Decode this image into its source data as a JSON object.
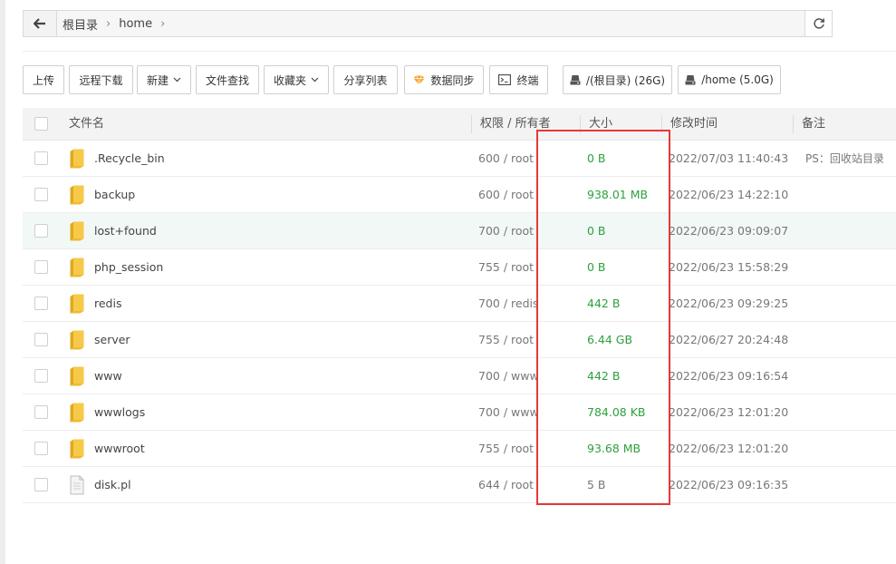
{
  "path": {
    "crumbs": [
      "根目录",
      "home"
    ],
    "back_icon": "arrow-left-icon",
    "refresh_icon": "refresh-icon"
  },
  "toolbar": {
    "upload": "上传",
    "remote_download": "远程下载",
    "new": "新建",
    "file_search": "文件查找",
    "favorites": "收藏夹",
    "share_list": "分享列表",
    "data_sync": "数据同步",
    "terminal": "终端",
    "disk_root": "/(根目录) (26G)",
    "disk_home": "/home (5.0G)"
  },
  "table": {
    "headers": {
      "name": "文件名",
      "perm": "权限 / 所有者",
      "size": "大小",
      "mtime": "修改时间",
      "note": "备注"
    },
    "rows": [
      {
        "name": ".Recycle_bin",
        "type": "folder",
        "perm": "600 / root",
        "size": "0 B",
        "mtime": "2022/07/03 11:40:43",
        "note": "PS：回收站目录"
      },
      {
        "name": "backup",
        "type": "folder",
        "perm": "600 / root",
        "size": "938.01 MB",
        "mtime": "2022/06/23 14:22:10",
        "note": ""
      },
      {
        "name": "lost+found",
        "type": "folder",
        "perm": "700 / root",
        "size": "0 B",
        "mtime": "2022/06/23 09:09:07",
        "note": ""
      },
      {
        "name": "php_session",
        "type": "folder",
        "perm": "755 / root",
        "size": "0 B",
        "mtime": "2022/06/23 15:58:29",
        "note": ""
      },
      {
        "name": "redis",
        "type": "folder",
        "perm": "700 / redis",
        "size": "442 B",
        "mtime": "2022/06/23 09:29:25",
        "note": ""
      },
      {
        "name": "server",
        "type": "folder",
        "perm": "755 / root",
        "size": "6.44 GB",
        "mtime": "2022/06/27 20:24:48",
        "note": ""
      },
      {
        "name": "www",
        "type": "folder",
        "perm": "700 / www",
        "size": "442 B",
        "mtime": "2022/06/23 09:16:54",
        "note": ""
      },
      {
        "name": "wwwlogs",
        "type": "folder",
        "perm": "700 / www",
        "size": "784.08 KB",
        "mtime": "2022/06/23 12:01:20",
        "note": ""
      },
      {
        "name": "wwwroot",
        "type": "folder",
        "perm": "755 / root",
        "size": "93.68 MB",
        "mtime": "2022/06/23 12:01:20",
        "note": ""
      },
      {
        "name": "disk.pl",
        "type": "file",
        "perm": "644 / root",
        "size": "5 B",
        "mtime": "2022/06/23 09:16:35",
        "note": ""
      }
    ]
  },
  "colors": {
    "size_green": "#2ea03e",
    "highlight_box": "#e53935",
    "folder_yellow": "#f5c342"
  }
}
